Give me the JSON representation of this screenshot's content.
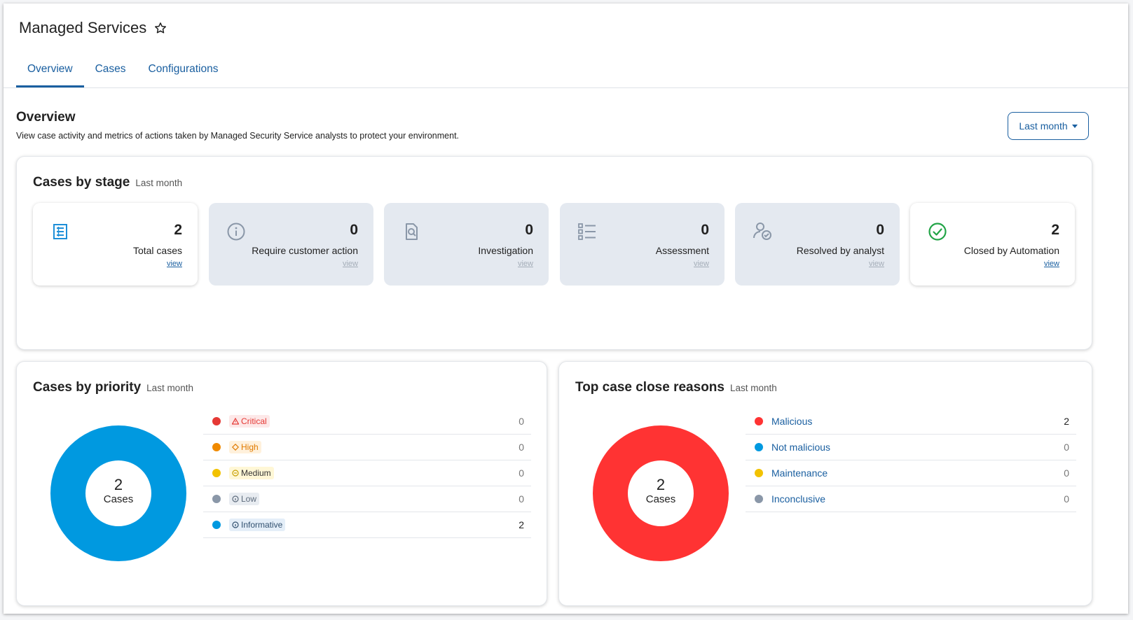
{
  "app": {
    "title": "Managed Services",
    "star_icon": "star-outline-icon"
  },
  "tabs": [
    {
      "label": "Overview",
      "active": true
    },
    {
      "label": "Cases",
      "active": false
    },
    {
      "label": "Configurations",
      "active": false
    }
  ],
  "overview": {
    "title": "Overview",
    "description": "View case activity and metrics of actions taken by Managed Security Service analysts to protect your environment.",
    "range_button": "Last month"
  },
  "stages": {
    "title": "Cases by stage",
    "subtitle": "Last month",
    "cards": [
      {
        "icon": "list-document-icon",
        "count": "2",
        "label": "Total cases",
        "link": "view",
        "enabled": true
      },
      {
        "icon": "info-circle-icon",
        "count": "0",
        "label": "Require customer action",
        "link": "view",
        "enabled": false
      },
      {
        "icon": "document-search-icon",
        "count": "0",
        "label": "Investigation",
        "link": "view",
        "enabled": false
      },
      {
        "icon": "checklist-icon",
        "count": "0",
        "label": "Assessment",
        "link": "view",
        "enabled": false
      },
      {
        "icon": "user-check-icon",
        "count": "0",
        "label": "Resolved by analyst",
        "link": "view",
        "enabled": false
      },
      {
        "icon": "check-circle-icon",
        "count": "2",
        "label": "Closed by Automation",
        "link": "view",
        "enabled": true
      }
    ]
  },
  "priority": {
    "title": "Cases by priority",
    "subtitle": "Last month",
    "total": "2",
    "total_label": "Cases",
    "donut_color": "#0099e0",
    "rows": [
      {
        "label": "Critical",
        "icon": "warning-triangle-icon",
        "value": "0",
        "dot": "#e53935",
        "text": "#e53935",
        "bg": "#fde8e8"
      },
      {
        "label": "High",
        "icon": "diamond-icon",
        "value": "0",
        "dot": "#f08a00",
        "text": "#e07a00",
        "bg": "#fff1dc"
      },
      {
        "label": "Medium",
        "icon": "circle-minus-icon",
        "value": "0",
        "dot": "#f2c200",
        "text": "#333333",
        "bg": "#fff7d6"
      },
      {
        "label": "Low",
        "icon": "circle-info-icon",
        "value": "0",
        "dot": "#8a97a8",
        "text": "#5d6b7c",
        "bg": "#e8ecf1"
      },
      {
        "label": "Informative",
        "icon": "circle-info-icon",
        "value": "2",
        "dot": "#0099e0",
        "text": "#31506f",
        "bg": "#e4eef8"
      }
    ]
  },
  "reasons": {
    "title": "Top case close reasons",
    "subtitle": "Last month",
    "total": "2",
    "total_label": "Cases",
    "donut_color": "#ff3333",
    "rows": [
      {
        "label": "Malicious",
        "value": "2",
        "dot": "#ff3333"
      },
      {
        "label": "Not malicious",
        "value": "0",
        "dot": "#0099e0"
      },
      {
        "label": "Maintenance",
        "value": "0",
        "dot": "#f2c200"
      },
      {
        "label": "Inconclusive",
        "value": "0",
        "dot": "#8a97a8"
      }
    ]
  }
}
